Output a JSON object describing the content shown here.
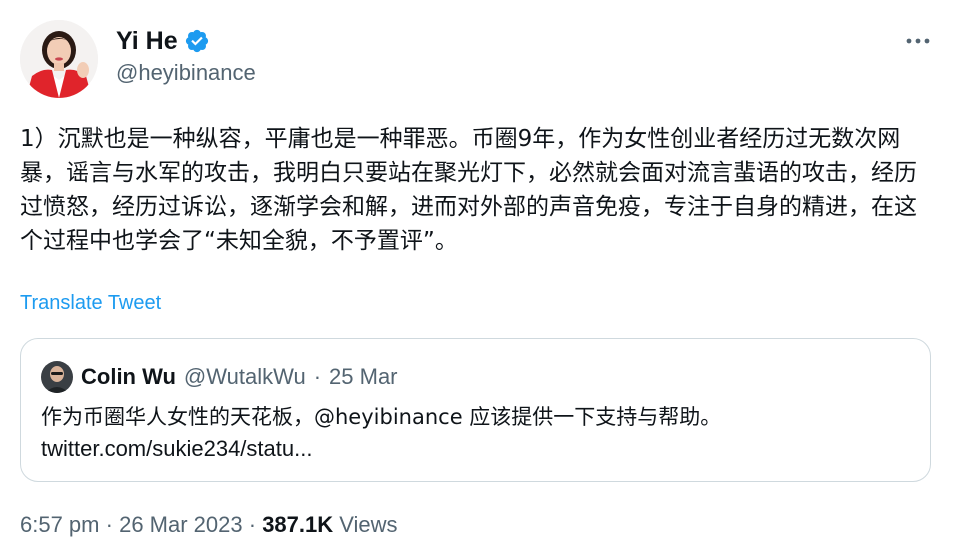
{
  "author": {
    "display_name": "Yi He",
    "handle": "@heyibinance",
    "verified": true,
    "verified_color": "#1d9bf0"
  },
  "icons": {
    "more": "more-horizontal-icon",
    "verified": "verified-badge-icon"
  },
  "tweet": {
    "text": "1）沉默也是一种纵容，平庸也是一种罪恶。币圈9年，作为女性创业者经历过无数次网暴，谣言与水军的攻击，我明白只要站在聚光灯下，必然就会面对流言蜚语的攻击，经历过愤怒，经历过诉讼，逐渐学会和解，进而对外部的声音免疫，专注于自身的精进，在这个过程中也学会了“未知全貌，不予置评”。",
    "translate_label": "Translate Tweet"
  },
  "quoted_tweet": {
    "display_name": "Colin Wu",
    "handle": "@WutalkWu",
    "separator": "·",
    "date": "25 Mar",
    "text": "作为币圈华人女性的天花板，@heyibinance 应该提供一下支持与帮助。",
    "link": "twitter.com/sukie234/statu..."
  },
  "footer": {
    "time": "6:57 pm",
    "separator1": "·",
    "date": "26 Mar 2023",
    "separator2": "·",
    "views_count": "387.1K",
    "views_label": "Views"
  },
  "colors": {
    "text_primary": "#0f1419",
    "text_secondary": "#536471",
    "link": "#1d9bf0",
    "border": "#cfd9de",
    "avatar_jacket": "#e0242b"
  }
}
